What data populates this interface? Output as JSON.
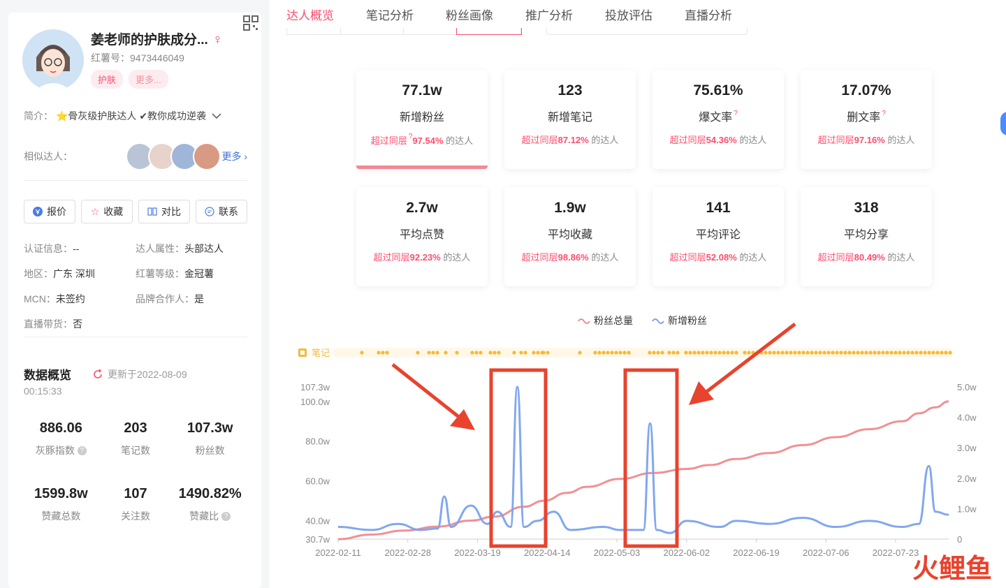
{
  "profile": {
    "name": "姜老师的护肤成分...",
    "gender_symbol": "♀",
    "red_id": "红薯号：9473446049",
    "tags": [
      "护肤",
      "更多..."
    ],
    "intro_label": "简介：",
    "intro_text": "⭐骨灰级护肤达人 ✔教你成功逆袭",
    "similar_label": "相似达人：",
    "similar_more": "更多",
    "buttons": [
      "报价",
      "收藏",
      "对比",
      "联系"
    ],
    "info": [
      {
        "k": "认证信息：",
        "v": "--"
      },
      {
        "k": "达人属性：",
        "v": "头部达人"
      },
      {
        "k": "地区：",
        "v": "广东 深圳"
      },
      {
        "k": "红薯等级：",
        "v": "金冠薯"
      },
      {
        "k": "MCN：",
        "v": "未签约"
      },
      {
        "k": "品牌合作人：",
        "v": "是"
      },
      {
        "k": "直播带货：",
        "v": "否"
      }
    ],
    "overview_title": "数据概览",
    "updated": "更新于2022-08-09",
    "updated_time": "00:15:33",
    "stats_row1": [
      {
        "n": "886.06",
        "l": "灰豚指数"
      },
      {
        "n": "203",
        "l": "笔记数"
      },
      {
        "n": "107.3w",
        "l": "粉丝数"
      }
    ],
    "stats_row2": [
      {
        "n": "1599.8w",
        "l": "赞藏总数"
      },
      {
        "n": "107",
        "l": "关注数"
      },
      {
        "n": "1490.82%",
        "l": "赞藏比"
      }
    ]
  },
  "tabs": [
    "达人概览",
    "笔记分析",
    "粉丝画像",
    "推广分析",
    "投放评估",
    "直播分析"
  ],
  "cards_row1": [
    {
      "value": "77.1w",
      "title": "新增粉丝",
      "prefix": "超过同层",
      "pct": "97.54%",
      "suffix": "的达人"
    },
    {
      "value": "123",
      "title": "新增笔记",
      "prefix": "超过同层",
      "pct": "87.12%",
      "suffix": "的达人"
    },
    {
      "value": "75.61%",
      "title": "爆文率",
      "prefix": "超过同层",
      "pct": "54.36%",
      "suffix": "的达人"
    },
    {
      "value": "17.07%",
      "title": "删文率",
      "prefix": "超过同层",
      "pct": "97.16%",
      "suffix": "的达人"
    }
  ],
  "cards_row2": [
    {
      "value": "2.7w",
      "title": "平均点赞",
      "prefix": "超过同层",
      "pct": "92.23%",
      "suffix": "的达人"
    },
    {
      "value": "1.9w",
      "title": "平均收藏",
      "prefix": "超过同层",
      "pct": "98.86%",
      "suffix": "的达人"
    },
    {
      "value": "141",
      "title": "平均评论",
      "prefix": "超过同层",
      "pct": "52.08%",
      "suffix": "的达人"
    },
    {
      "value": "318",
      "title": "平均分享",
      "prefix": "超过同层",
      "pct": "80.49%",
      "suffix": "的达人"
    }
  ],
  "colors": {
    "accent": "#ff4d6d",
    "total_line": "#f08a8f",
    "new_line": "#7aa2ee",
    "note_dot": "#f5b938",
    "box": "#e8432e"
  },
  "logo_text": "火鲤鱼",
  "chart_data": {
    "type": "line",
    "legend": [
      "粉丝总量",
      "新增粉丝"
    ],
    "notes_label": "笔记",
    "x_ticks": [
      "2022-02-11",
      "2022-02-28",
      "2022-03-19",
      "2022-04-14",
      "2022-05-03",
      "2022-06-02",
      "2022-06-19",
      "2022-07-06",
      "2022-07-23"
    ],
    "y_left_ticks": [
      "107.3w",
      "100.0w",
      "80.0w",
      "60.0w",
      "40.0w",
      "30.7w"
    ],
    "y_right_ticks": [
      "5.0w",
      "4.0w",
      "3.0w",
      "2.0w",
      "1.0w",
      "0"
    ],
    "y_left_range": [
      30.7,
      107.3
    ],
    "y_right_range": [
      0,
      5.0
    ],
    "series": [
      {
        "name": "粉丝总量",
        "axis": "left",
        "unit": "w",
        "points": [
          [
            0,
            30.7
          ],
          [
            10,
            33
          ],
          [
            20,
            35
          ],
          [
            30,
            37
          ],
          [
            40,
            40
          ],
          [
            47,
            42
          ],
          [
            56,
            47
          ],
          [
            62,
            50
          ],
          [
            69,
            54
          ],
          [
            75,
            57
          ],
          [
            85,
            61
          ],
          [
            95,
            64
          ],
          [
            105,
            66
          ],
          [
            112,
            68
          ],
          [
            120,
            71
          ],
          [
            130,
            74
          ],
          [
            140,
            78
          ],
          [
            150,
            82
          ],
          [
            160,
            86
          ],
          [
            170,
            90
          ],
          [
            175,
            94
          ],
          [
            180,
            97
          ],
          [
            184,
            100
          ]
        ]
      },
      {
        "name": "新增粉丝",
        "axis": "right",
        "unit": "w",
        "points": [
          [
            0,
            0.4
          ],
          [
            10,
            0.3
          ],
          [
            18,
            0.5
          ],
          [
            25,
            0.3
          ],
          [
            30,
            0.35
          ],
          [
            32,
            1.4
          ],
          [
            34,
            0.4
          ],
          [
            40,
            1.1
          ],
          [
            45,
            0.5
          ],
          [
            48,
            0.9
          ],
          [
            52,
            0.4
          ],
          [
            54,
            5.0
          ],
          [
            56,
            0.4
          ],
          [
            60,
            0.6
          ],
          [
            65,
            0.9
          ],
          [
            70,
            0.3
          ],
          [
            80,
            0.4
          ],
          [
            85,
            0.3
          ],
          [
            92,
            0.3
          ],
          [
            94,
            3.8
          ],
          [
            96,
            0.3
          ],
          [
            100,
            0.2
          ],
          [
            105,
            0.6
          ],
          [
            115,
            0.4
          ],
          [
            120,
            0.6
          ],
          [
            130,
            0.5
          ],
          [
            140,
            0.7
          ],
          [
            150,
            0.4
          ],
          [
            160,
            0.6
          ],
          [
            170,
            0.4
          ],
          [
            175,
            0.5
          ],
          [
            178,
            2.4
          ],
          [
            180,
            0.9
          ],
          [
            184,
            0.8
          ]
        ]
      }
    ],
    "x_range": [
      0,
      184
    ]
  }
}
